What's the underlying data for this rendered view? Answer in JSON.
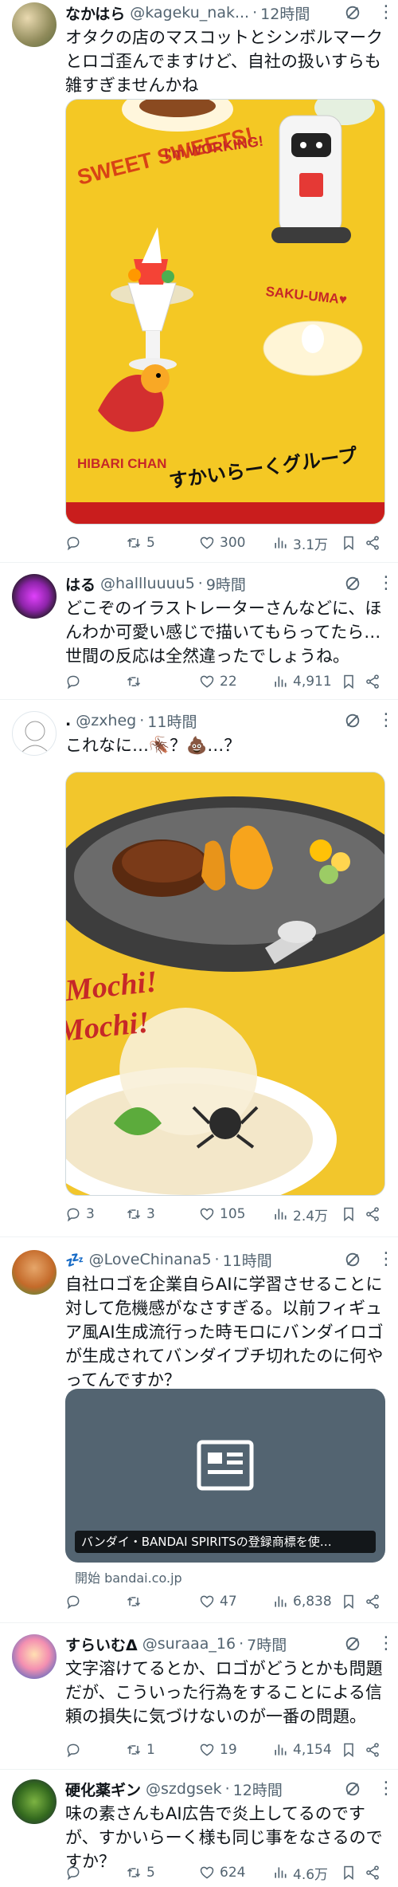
{
  "colors": {
    "text": "#0f1419",
    "secondary": "#536471",
    "divider": "#eff3f4"
  },
  "posts": [
    {
      "name": "なかはら",
      "handle": "@kageku_nak...",
      "time": "12時間",
      "text": "オタクの店のマスコットとシンボルマークとロゴ歪んでますけど、自社の扱いすらも雑すぎませんかね",
      "media_labels": {
        "sweet": "SWEET SWEETS!",
        "working": "I'm WORKING!",
        "sakuuma": "SAKU-UMA♥",
        "hibari": "HIBARI CHAN",
        "logo": "すかいらーくグループ"
      },
      "reply_count": "",
      "retweet_count": "5",
      "like_count": "300",
      "view_count": "3.1万"
    },
    {
      "name": "はる",
      "handle": "@hallluuuu5",
      "time": "9時間",
      "text": "どこぞのイラストレーターさんなどに、ほんわか可愛い感じで描いてもらってたら…世間の反応は全然違ったでしょうね。",
      "reply_count": "",
      "retweet_count": "",
      "like_count": "22",
      "view_count": "4,911"
    },
    {
      "name": ".",
      "handle": "@zxheg",
      "time": "11時間",
      "text": "これなに…🪳？💩…？",
      "media_labels": {
        "mochi1": "Mochi!",
        "mochi2": "Mochi!"
      },
      "reply_count": "3",
      "retweet_count": "3",
      "like_count": "105",
      "view_count": "2.4万"
    },
    {
      "name": "💤",
      "handle": "@LoveChinana5",
      "time": "11時間",
      "text": "自社ロゴを企業自らAIに学習させることに対して危機感がなさすぎる。以前フィギュア風AI生成流行った時モロにバンダイロゴが生成されてバンダイブチ切れたのに何やってんですか？",
      "link_title": "バンダイ・BANDAI SPIRITSの登録商標を使…",
      "link_source": "開始 bandai.co.jp",
      "reply_count": "",
      "retweet_count": "",
      "like_count": "47",
      "view_count": "6,838"
    },
    {
      "name": "すらいむΔ",
      "handle": "@suraaa_16",
      "time": "7時間",
      "text": "文字溶けてるとか、ロゴがどうとかも問題だが、こういった行為をすることによる信頼の損失に気づけないのが一番の問題。",
      "reply_count": "",
      "retweet_count": "1",
      "like_count": "19",
      "view_count": "4,154"
    },
    {
      "name": "硬化薬ギン",
      "handle": "@szdgsek",
      "time": "12時間",
      "text": "味の素さんもAI広告で炎上してるのですが、すかいらーく様も同じ事をなさるのですか？",
      "reply_count": "",
      "retweet_count": "5",
      "like_count": "624",
      "view_count": "4.6万"
    }
  ],
  "icons": [
    "reply-icon",
    "retweet-icon",
    "like-icon",
    "views-icon",
    "bookmark-icon",
    "share-icon",
    "grok-icon",
    "more-icon",
    "article-icon"
  ]
}
